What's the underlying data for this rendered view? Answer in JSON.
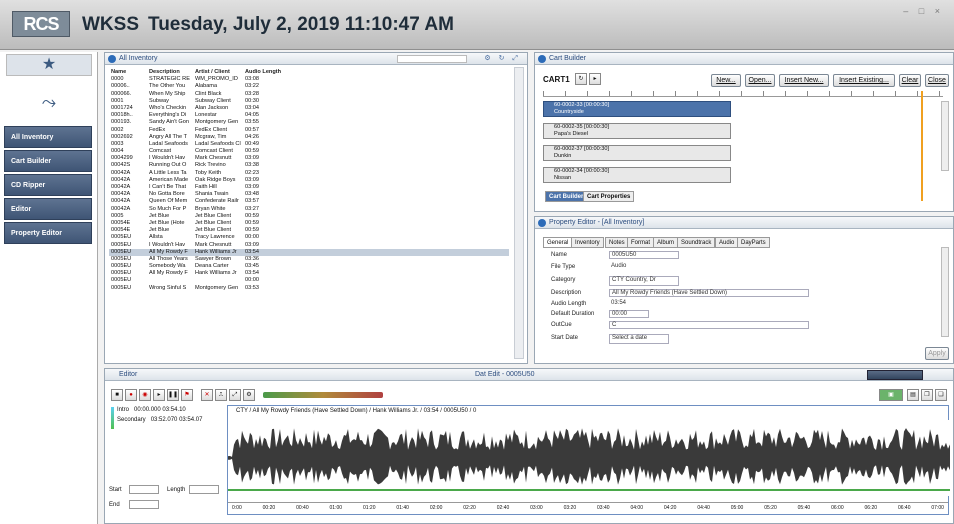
{
  "header": {
    "logo": "RCS",
    "station": "WKSS",
    "datetime": "Tuesday, July 2, 2019 11:10:47 AM",
    "window_controls": "– □ ×"
  },
  "nav": {
    "star": "★",
    "items": [
      {
        "label": "All Inventory"
      },
      {
        "label": "Cart Builder"
      },
      {
        "label": "CD Ripper"
      },
      {
        "label": "Editor"
      },
      {
        "label": "Property Editor"
      }
    ]
  },
  "inventory": {
    "title": "All Inventory",
    "columns": [
      "Name",
      "Description",
      "Artist / Client",
      "Audio Length"
    ],
    "rows": [
      [
        "0000",
        "STRATEGIC RE",
        "WM_PROMO_ID",
        "03:08"
      ],
      [
        "00006..",
        "The Other You",
        "Alabama",
        "03:22"
      ],
      [
        "000066.",
        "When My Ship",
        "Clint Black",
        "03:28"
      ],
      [
        "0001",
        "Subway",
        "Subway Client",
        "00:30"
      ],
      [
        "0001724",
        "Who's Checkin",
        "Alan Jackson",
        "03:04"
      ],
      [
        "00018h..",
        "Everything's Di",
        "Lonestar",
        "04:05"
      ],
      [
        "000193.",
        "Sandy Ain't Gon",
        "Montgomery Gen",
        "03:55"
      ],
      [
        "0002",
        "FedEx",
        "FedEx Client",
        "00:57"
      ],
      [
        "0002692",
        "Angry All The T",
        "Mcgraw, Tim",
        "04:26"
      ],
      [
        "0003",
        "Ladal Seafoods",
        "Ladal Seafoods Cl",
        "00:49"
      ],
      [
        "0004",
        "Comcast",
        "Comcast Client",
        "00:59"
      ],
      [
        "0004299",
        "I Wouldn't Hav",
        "Mark Chesnutt",
        "03:09"
      ],
      [
        "00042S",
        "Running Out O",
        "Rick Trevino",
        "03:38"
      ],
      [
        "00042A",
        "A Little Less Ta",
        "Toby Keith",
        "02:23"
      ],
      [
        "00042A",
        "American Made",
        "Oak Ridge Boys",
        "03:09"
      ],
      [
        "00042A",
        "I Can't Be That",
        "Faith Hill",
        "03:09"
      ],
      [
        "00042A",
        "No Gotta Bore",
        "Shania Twain",
        "03:48"
      ],
      [
        "00042A",
        "Queen Of Mem",
        "Confederate Railr",
        "03:57"
      ],
      [
        "00042A",
        "So Much For P",
        "Bryan White",
        "03:27"
      ],
      [
        "0005",
        "Jet Blue",
        "Jet Blue Client",
        "00:59"
      ],
      [
        "00054E",
        "Jet Blue (Hote",
        "Jet Blue Client",
        "00:59"
      ],
      [
        "00054E",
        "Jet Blue",
        "Jet Blue Client",
        "00:59"
      ],
      [
        "0005EU",
        "Allsta",
        "Tracy Lawrence",
        "00:00"
      ],
      [
        "0005EU",
        "I Wouldn't Hav",
        "Mark Chesnutt",
        "03:09"
      ],
      [
        "0005EU",
        "All My Rowdy F",
        "Hank Williams Jr",
        "03:54"
      ],
      [
        "0005EU",
        "All Those Years",
        "Sawyer Brown",
        "03:36"
      ],
      [
        "0005EU",
        "Somebody Wa",
        "Deana Carter",
        "03:45"
      ],
      [
        "0005EU",
        "All My Rowdy F",
        "Hank Williams Jr",
        "03:54"
      ],
      [
        "0005EU",
        "",
        "",
        "00:00"
      ],
      [
        "0005EU",
        "Wrong Sinful S",
        "Montgomery Gen",
        "03:53"
      ]
    ],
    "selected_row": 24
  },
  "cart": {
    "title": "Cart Builder",
    "name": "CART1",
    "buttons": [
      "New...",
      "Open...",
      "Insert New...",
      "Insert Existing...",
      "Clear",
      "Close"
    ],
    "items": [
      {
        "text": "60-0002-33 [00:00:30]",
        "sub": "Countryside"
      },
      {
        "text": "60-0002-35 [00:00:30]",
        "sub": "Papa's Diesel"
      },
      {
        "text": "60-0002-37 [00:00:30]",
        "sub": "Dunkin"
      },
      {
        "text": "60-0002-34 [00:00:30]",
        "sub": "Nissan"
      }
    ],
    "tabs": [
      "Cart Builder",
      "Cart Properties"
    ]
  },
  "property": {
    "title": "Property Editor - [All Inventory]",
    "tabs": [
      "General",
      "Inventory",
      "Notes",
      "Format",
      "Album",
      "Soundtrack",
      "Audio",
      "DayParts"
    ],
    "fields": [
      {
        "label": "Name",
        "value": "0005U50"
      },
      {
        "label": "File Type",
        "value": "Audio"
      },
      {
        "label": "Category",
        "value": "CTY     Country, Dr"
      },
      {
        "label": "Description",
        "value": "All My Rowdy Friends (Have Settled Down)"
      },
      {
        "label": "Audio Length",
        "value": "03:54"
      },
      {
        "label": "Default Duration",
        "value": "00:00"
      },
      {
        "label": "OutCue",
        "value": "C"
      },
      {
        "label": "Start Date",
        "value": "Select a date"
      }
    ],
    "apply": "Apply"
  },
  "editor": {
    "title": "Editor",
    "center_title": "Dat Edit - 0005U50",
    "markers": [
      {
        "name": "Intro",
        "time": "00:00.000",
        "len": "03:54.10"
      },
      {
        "name": "Secondary",
        "time": "03:52.070",
        "len": "03:54.07"
      }
    ],
    "info": "CTY / All My Rowdy Friends (Have Settled Down) / Hank Williams Jr. / 03:54 / 0005U50 / 0",
    "start_label": "Start",
    "length_label": "Length",
    "end_label": "End",
    "timeline": [
      "0:00",
      "00:20",
      "00:40",
      "01:00",
      "01:20",
      "01:40",
      "02:00",
      "02:20",
      "02:40",
      "03:00",
      "03:20",
      "03:40",
      "04:00",
      "04:20",
      "04:40",
      "05:00",
      "05:20",
      "05:40",
      "06:00",
      "06:20",
      "06:40",
      "07:00"
    ]
  }
}
